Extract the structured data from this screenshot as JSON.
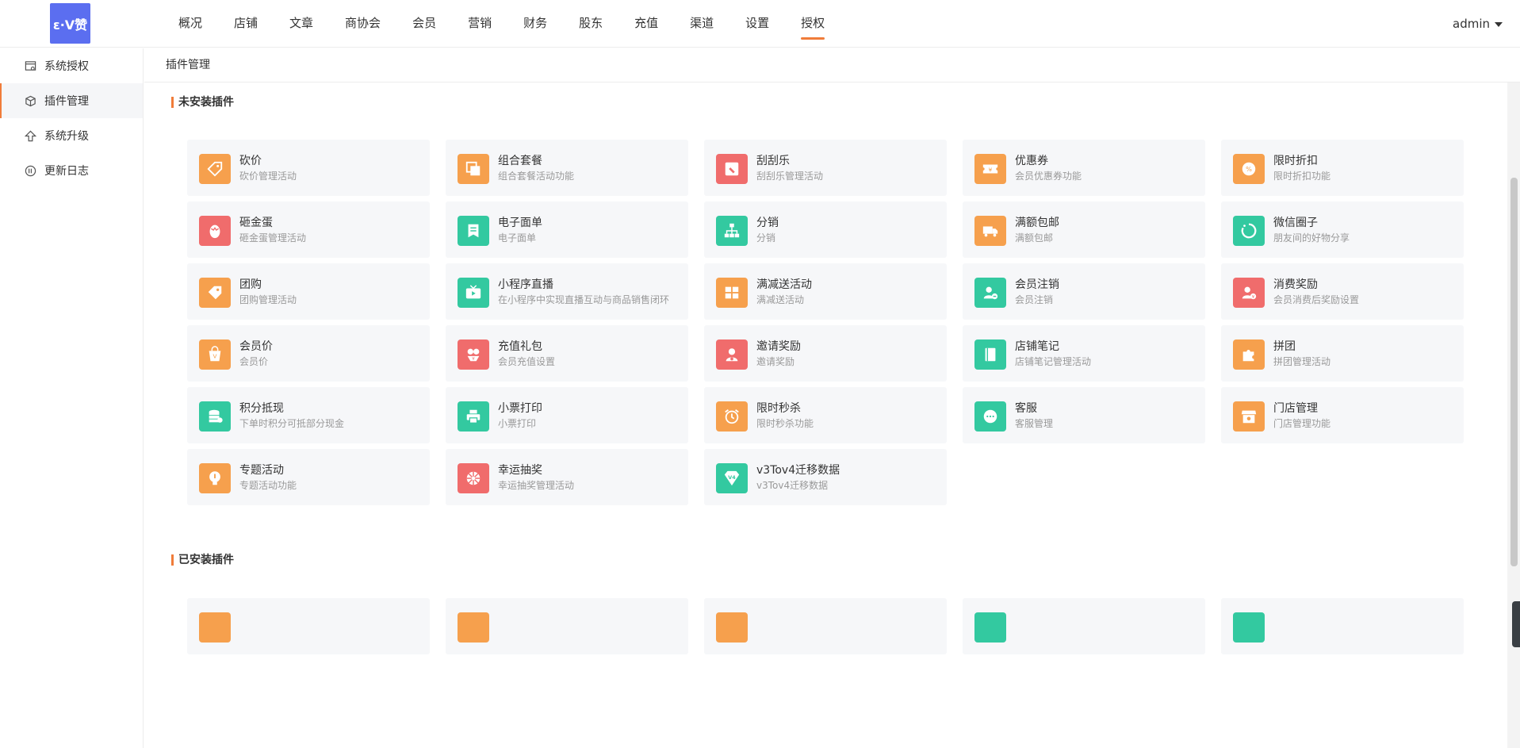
{
  "brand": {
    "logo_text": "ε·V赞"
  },
  "nav": {
    "items": [
      "概况",
      "店铺",
      "文章",
      "商协会",
      "会员",
      "营销",
      "财务",
      "股东",
      "充值",
      "渠道",
      "设置",
      "授权"
    ],
    "active_index": 11
  },
  "user": {
    "name": "admin"
  },
  "sidebar": {
    "items": [
      {
        "label": "系统授权",
        "icon": "license-icon"
      },
      {
        "label": "插件管理",
        "icon": "cube-icon"
      },
      {
        "label": "系统升级",
        "icon": "upgrade-arrow-icon"
      },
      {
        "label": "更新日志",
        "icon": "changelog-icon"
      }
    ],
    "active_index": 1
  },
  "breadcrumb": "插件管理",
  "sections": {
    "uninstalled_title": "未安装插件",
    "installed_title": "已安装插件"
  },
  "plugins": [
    {
      "name": "砍价",
      "desc": "砍价管理活动",
      "color": "orange",
      "icon": "tag-cut-icon"
    },
    {
      "name": "组合套餐",
      "desc": "组合套餐活动功能",
      "color": "orange",
      "icon": "combo-icon"
    },
    {
      "name": "刮刮乐",
      "desc": "刮刮乐管理活动",
      "color": "red",
      "icon": "scratch-card-icon"
    },
    {
      "name": "优惠券",
      "desc": "会员优惠券功能",
      "color": "orange",
      "icon": "coupon-icon"
    },
    {
      "name": "限时折扣",
      "desc": "限时折扣功能",
      "color": "orange",
      "icon": "discount-icon"
    },
    {
      "name": "砸金蛋",
      "desc": "砸金蛋管理活动",
      "color": "red",
      "icon": "golden-egg-icon"
    },
    {
      "name": "电子面单",
      "desc": "电子面单",
      "color": "green",
      "icon": "waybill-icon"
    },
    {
      "name": "分销",
      "desc": "分销",
      "color": "green",
      "icon": "hierarchy-icon"
    },
    {
      "name": "满额包邮",
      "desc": "满额包邮",
      "color": "orange",
      "icon": "truck-icon"
    },
    {
      "name": "微信圈子",
      "desc": "朋友间的好物分享",
      "color": "green",
      "icon": "circle-icon"
    },
    {
      "name": "团购",
      "desc": "团购管理活动",
      "color": "orange",
      "icon": "price-tag-icon"
    },
    {
      "name": "小程序直播",
      "desc": "在小程序中实现直播互动与商品销售闭环",
      "color": "green",
      "icon": "live-tv-icon"
    },
    {
      "name": "满减送活动",
      "desc": "满减送活动",
      "color": "orange",
      "icon": "ticket-icon"
    },
    {
      "name": "会员注销",
      "desc": "会员注销",
      "color": "green",
      "icon": "user-cancel-icon"
    },
    {
      "name": "消费奖励",
      "desc": "会员消费后奖励设置",
      "color": "red",
      "icon": "user-reward-icon"
    },
    {
      "name": "会员价",
      "desc": "会员价",
      "color": "orange",
      "icon": "member-price-icon"
    },
    {
      "name": "充值礼包",
      "desc": "会员充值设置",
      "color": "red",
      "icon": "gift-pack-icon"
    },
    {
      "name": "邀请奖励",
      "desc": "邀请奖励",
      "color": "red",
      "icon": "invite-icon"
    },
    {
      "name": "店铺笔记",
      "desc": "店铺笔记管理活动",
      "color": "green",
      "icon": "notebook-icon"
    },
    {
      "name": "拼团",
      "desc": "拼团管理活动",
      "color": "orange",
      "icon": "puzzle-icon"
    },
    {
      "name": "积分抵现",
      "desc": "下单时积分可抵部分现金",
      "color": "green",
      "icon": "coins-icon"
    },
    {
      "name": "小票打印",
      "desc": "小票打印",
      "color": "green",
      "icon": "printer-icon"
    },
    {
      "name": "限时秒杀",
      "desc": "限时秒杀功能",
      "color": "orange",
      "icon": "alarm-clock-icon"
    },
    {
      "name": "客服",
      "desc": "客服管理",
      "color": "green",
      "icon": "chat-icon"
    },
    {
      "name": "门店管理",
      "desc": "门店管理功能",
      "color": "orange",
      "icon": "store-icon"
    },
    {
      "name": "专题活动",
      "desc": "专题活动功能",
      "color": "orange",
      "icon": "bulb-icon"
    },
    {
      "name": "幸运抽奖",
      "desc": "幸运抽奖管理活动",
      "color": "red",
      "icon": "lucky-wheel-icon"
    },
    {
      "name": "v3Tov4迁移数据",
      "desc": "v3Tov4迁移数据",
      "color": "green",
      "icon": "v4-badge-icon"
    }
  ],
  "installed_plugins_partial": [
    {
      "color": "orange"
    },
    {
      "color": "orange"
    },
    {
      "color": "orange"
    },
    {
      "color": "green"
    },
    {
      "color": "green"
    }
  ]
}
